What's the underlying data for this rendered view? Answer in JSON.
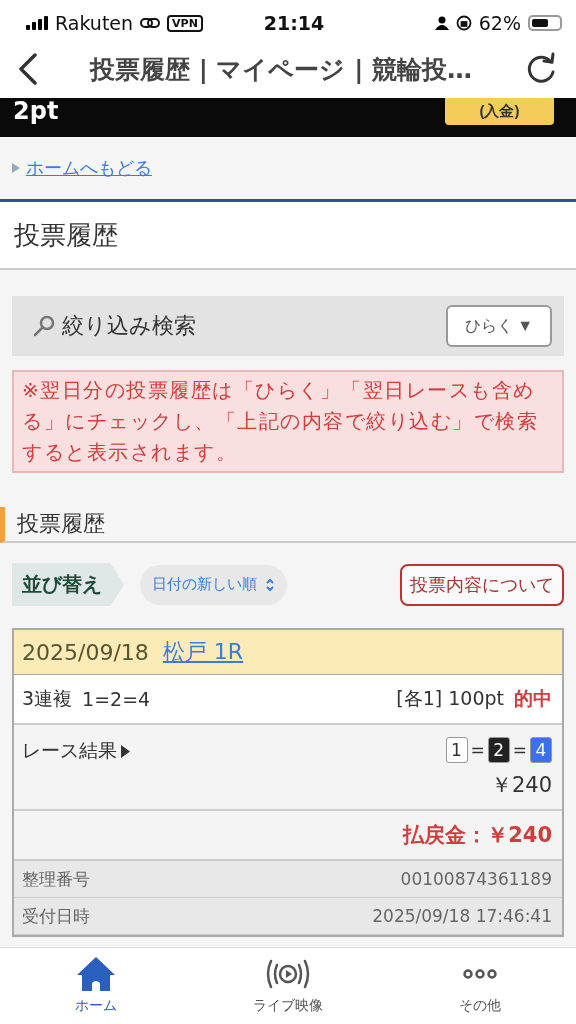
{
  "status_bar": {
    "carrier": "Rakuten",
    "vpn": "VPN",
    "time": "21:14",
    "battery": "62%"
  },
  "nav": {
    "title": "投票履歴 | マイページ | 競輪投…"
  },
  "balance": {
    "amount": "2pt",
    "deposit_button": "(入金)"
  },
  "breadcrumb": {
    "link": "ホームへもどる"
  },
  "page_title": "投票履歴",
  "filter": {
    "title": "絞り込み検索",
    "toggle": "ひらく ▼"
  },
  "notice": "※翌日分の投票履歴は「ひらく」「翌日レースも含める」にチェックし、「上記の内容で絞り込む」で検索すると表示されます。",
  "section_title": "投票履歴",
  "sort": {
    "label": "並び替え",
    "value": "日付の新しい順",
    "about_button": "投票内容について"
  },
  "tickets": [
    {
      "date": "2025/09/18",
      "race": "松戸 1R",
      "bet_type": "3連複",
      "combination": "1=2=4",
      "stake": "[各1] 100pt",
      "hit": true,
      "hit_label": "的中",
      "result_label": "レース結果",
      "result": [
        {
          "num": "1",
          "color": "#ffffff"
        },
        {
          "num": "2",
          "color": "#222222"
        },
        {
          "num": "4",
          "color": "#3a6ff0"
        }
      ],
      "separator": "=",
      "odds": "￥240",
      "payout": "払戻金：￥240",
      "details": [
        {
          "label": "整理番号",
          "value": "00100874361189"
        },
        {
          "label": "受付日時",
          "value": "2025/09/18 17:46:41"
        }
      ]
    }
  ],
  "tab_bar": [
    {
      "label": "ホーム",
      "kind": "home",
      "selected": true
    },
    {
      "label": "ライブ映像",
      "kind": "live",
      "selected": false
    },
    {
      "label": "その他",
      "kind": "more",
      "selected": false
    }
  ]
}
